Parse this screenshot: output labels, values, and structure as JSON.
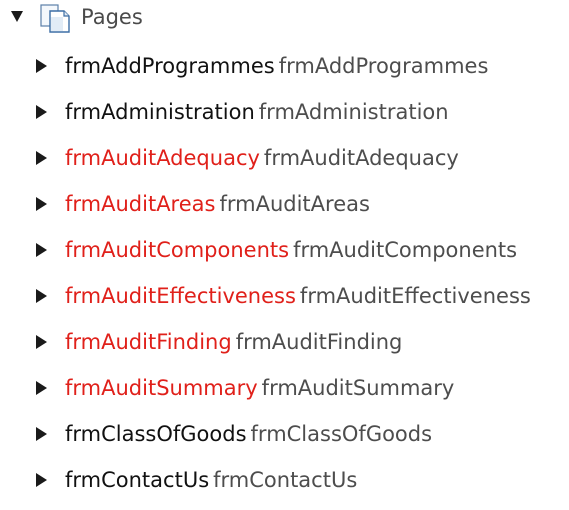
{
  "tree": {
    "root": {
      "label": "Pages",
      "icon": "pages-icon",
      "expanded": true
    },
    "colors": {
      "normal": "#111111",
      "error": "#e0201a",
      "description": "#4d4d4d"
    },
    "items": [
      {
        "name": "frmAddProgrammes",
        "description": "frmAddProgrammes",
        "status": "normal"
      },
      {
        "name": "frmAdministration",
        "description": "frmAdministration",
        "status": "normal"
      },
      {
        "name": "frmAuditAdequacy",
        "description": "frmAuditAdequacy",
        "status": "error"
      },
      {
        "name": "frmAuditAreas",
        "description": "frmAuditAreas",
        "status": "error"
      },
      {
        "name": "frmAuditComponents",
        "description": "frmAuditComponents",
        "status": "error"
      },
      {
        "name": "frmAuditEffectiveness",
        "description": "frmAuditEffectiveness",
        "status": "error"
      },
      {
        "name": "frmAuditFinding",
        "description": "frmAuditFinding",
        "status": "error"
      },
      {
        "name": "frmAuditSummary",
        "description": "frmAuditSummary",
        "status": "error"
      },
      {
        "name": "frmClassOfGoods",
        "description": "frmClassOfGoods",
        "status": "normal"
      },
      {
        "name": "frmContactUs",
        "description": "frmContactUs",
        "status": "normal"
      }
    ]
  }
}
